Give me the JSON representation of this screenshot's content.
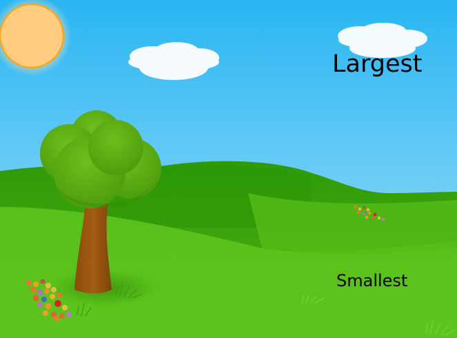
{
  "labels": {
    "largest": "Largest",
    "smallest": "Smallest"
  },
  "colors": {
    "sky_top": "#29b6f2",
    "sky_bottom": "#9ddcf8",
    "sun": "#ffcc80",
    "sun_outline": "#f5a623",
    "cloud": "#ffffff",
    "grass_light": "#5cc31a",
    "grass_dark": "#2f9a0a",
    "trunk": "#9a5510",
    "foliage": "#5aa80f"
  }
}
